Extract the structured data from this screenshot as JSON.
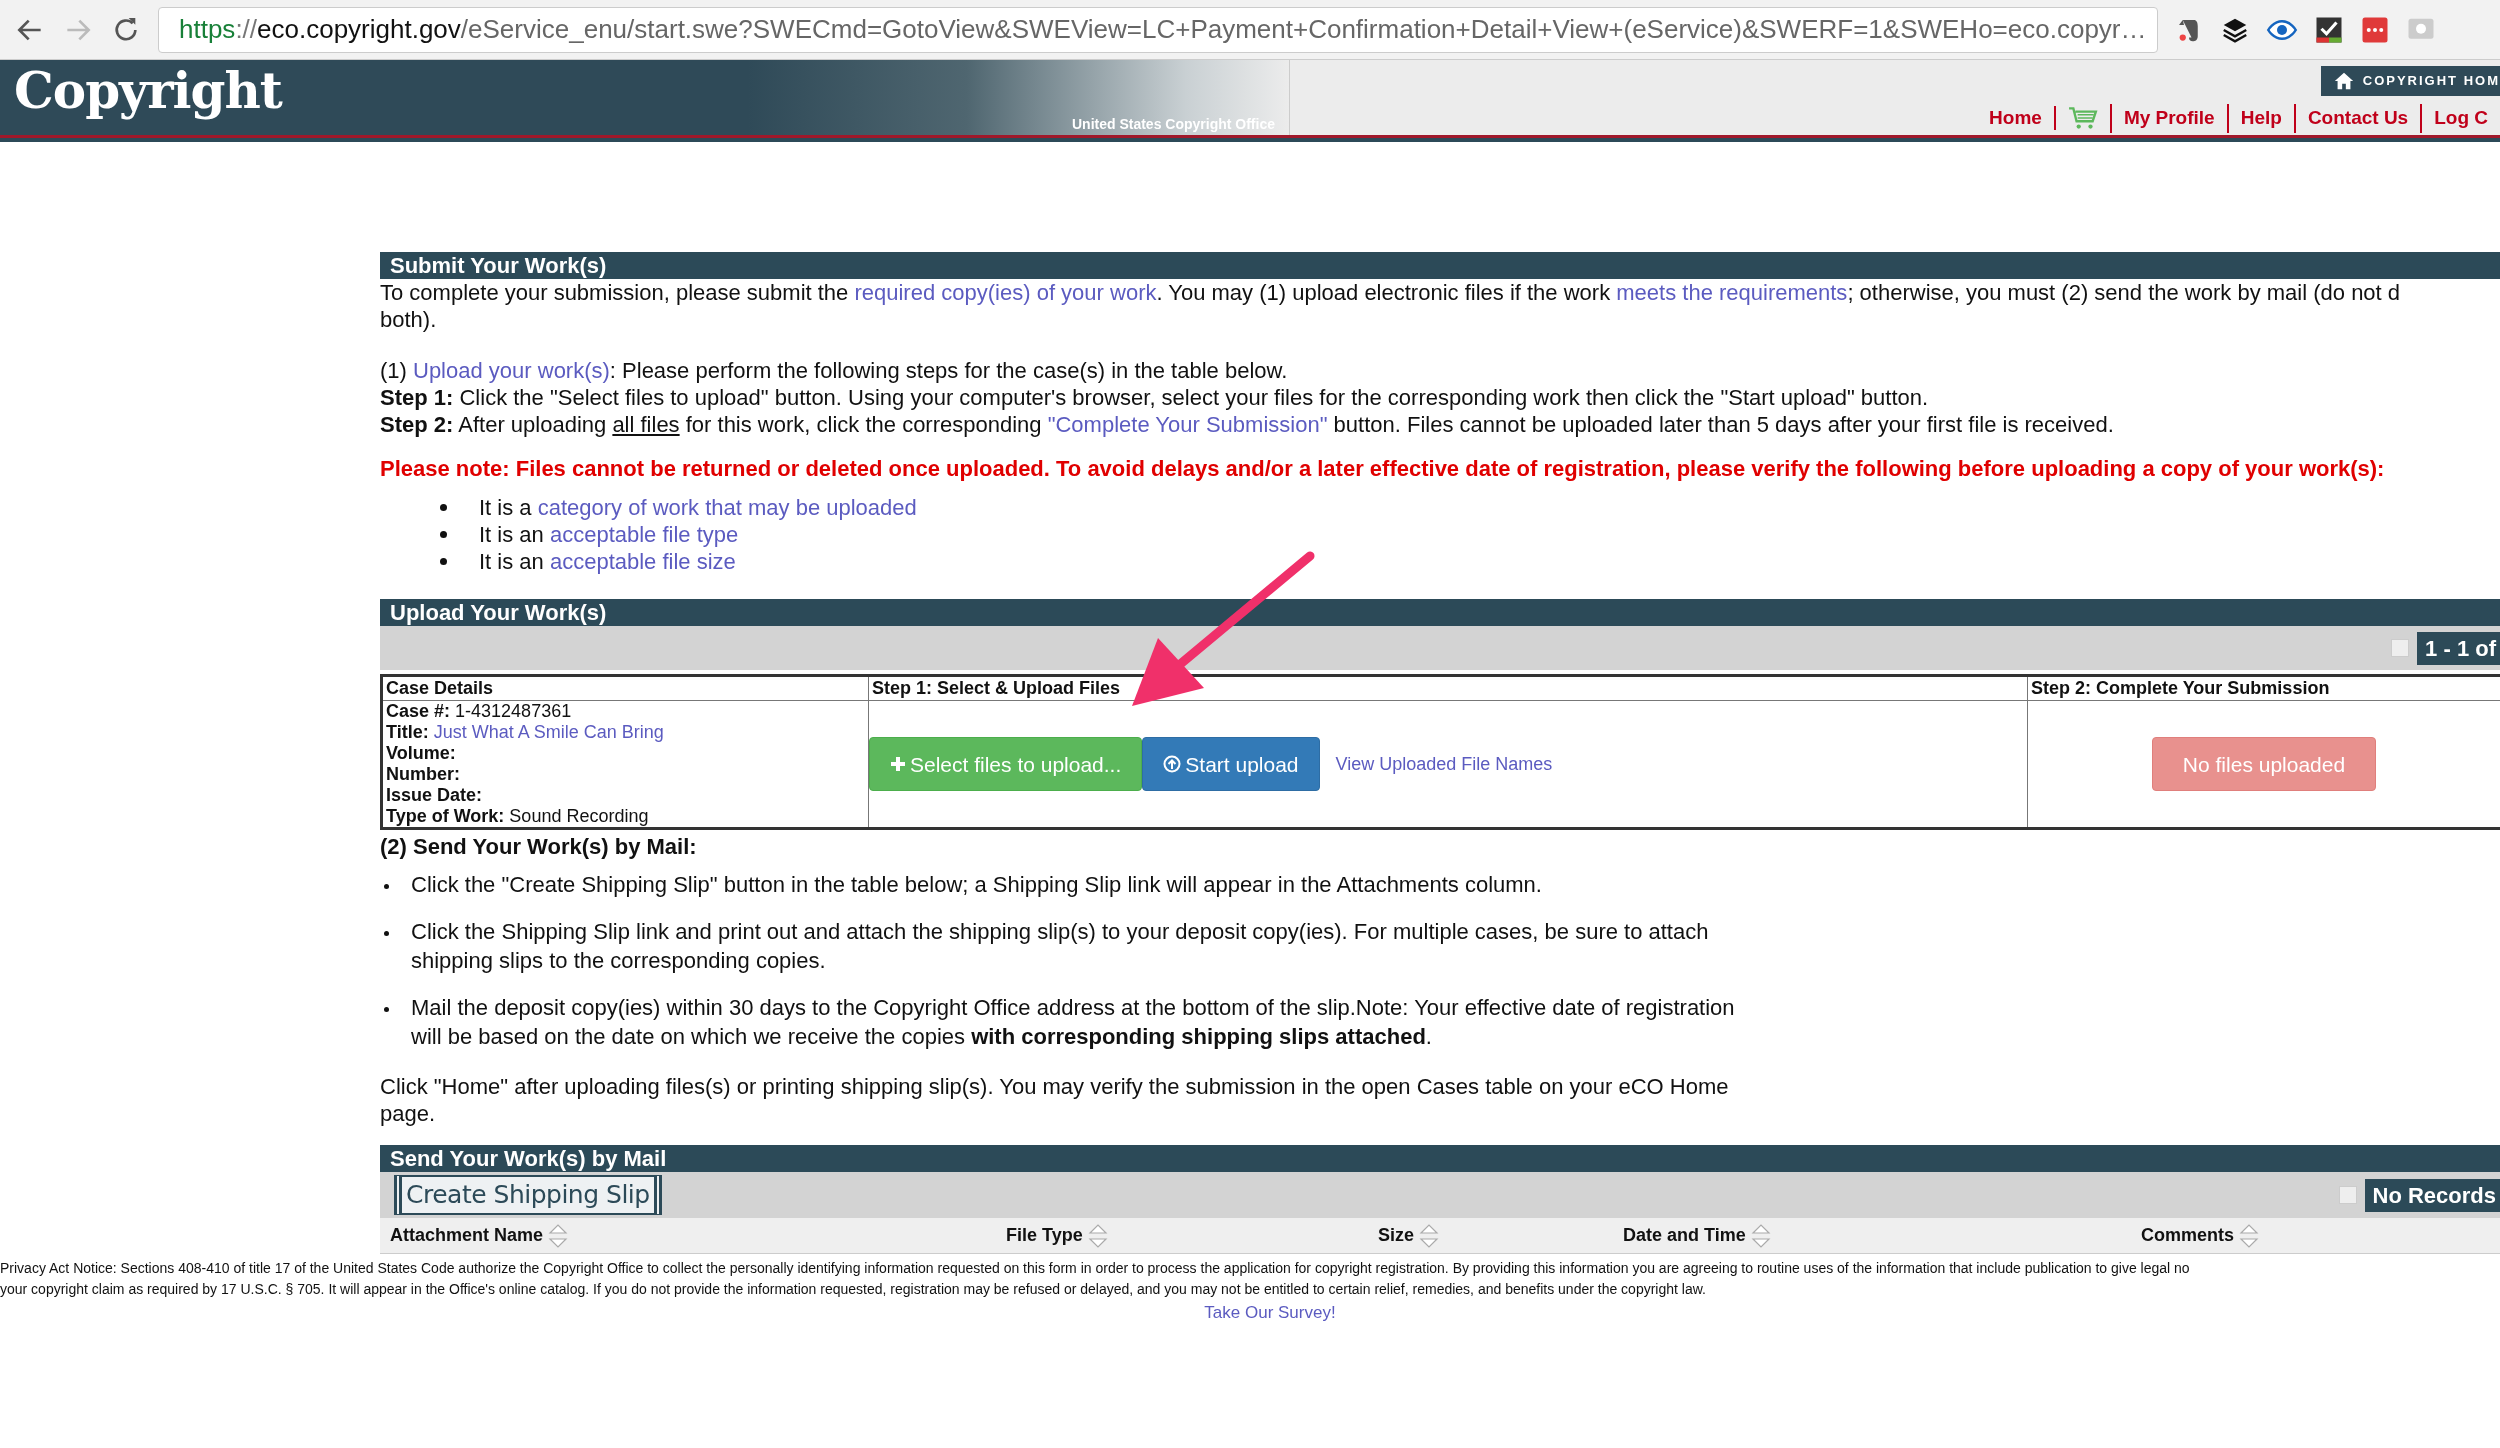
{
  "browser": {
    "url": {
      "scheme": "https",
      "separator": "://",
      "host": "eco.copyright.gov",
      "path": "/eService_enu/start.swe?SWECmd=GotoView&SWEView=LC+Payment+Confirmation+Detail+View+(eService)&SWERF=1&SWEHo=eco.copyr…"
    }
  },
  "header": {
    "logo": "Copyright",
    "logo_subtitle": "United States Copyright Office",
    "home_badge": "COPYRIGHT HOM",
    "nav": [
      {
        "kind": "link",
        "label": "Home"
      },
      {
        "kind": "cart"
      },
      {
        "kind": "link",
        "label": "My Profile"
      },
      {
        "kind": "link",
        "label": "Help"
      },
      {
        "kind": "link",
        "label": "Contact Us"
      },
      {
        "kind": "link",
        "label": "Log C"
      }
    ]
  },
  "submit_section": {
    "title": "Submit Your Work(s)",
    "intro_lines": [
      [
        {
          "kind": "text",
          "text": "To complete your submission, please submit the "
        },
        {
          "kind": "link",
          "text": "required copy(ies) of your work"
        },
        {
          "kind": "text",
          "text": ". You may (1) upload electronic files if the work "
        },
        {
          "kind": "link",
          "text": "meets the requirements"
        },
        {
          "kind": "text",
          "text": "; otherwise, you must (2) send the work by mail (do not d"
        }
      ],
      [
        {
          "kind": "text",
          "text": "both)."
        }
      ]
    ],
    "upload_line": [
      {
        "kind": "text",
        "text": "(1) "
      },
      {
        "kind": "link",
        "text": "Upload your work(s)"
      },
      {
        "kind": "text",
        "text": ": Please perform the following steps for the case(s) in the table below."
      }
    ],
    "steps": [
      [
        {
          "kind": "bold",
          "text": "Step 1:"
        },
        {
          "kind": "text",
          "text": " Click the \"Select files to upload\" button. Using your computer's browser, select your files for the corresponding work then click the \"Start upload\" button."
        }
      ],
      [
        {
          "kind": "bold",
          "text": "Step 2:"
        },
        {
          "kind": "text",
          "text": " After uploading "
        },
        {
          "kind": "underline",
          "text": "all files"
        },
        {
          "kind": "text",
          "text": " for this work, click the corresponding "
        },
        {
          "kind": "link",
          "text": "\"Complete Your Submission\""
        },
        {
          "kind": "text",
          "text": " button. Files cannot be uploaded later than 5 days after your first file is received."
        }
      ]
    ],
    "note": "Please note: Files cannot be returned or deleted once uploaded. To avoid delays and/or a later effective date of registration, please verify the following before uploading a copy of your work(s):",
    "checks": [
      [
        {
          "kind": "text",
          "text": "It is a "
        },
        {
          "kind": "link",
          "text": "category of work that may be uploaded"
        }
      ],
      [
        {
          "kind": "text",
          "text": "It is an "
        },
        {
          "kind": "link",
          "text": "acceptable file type"
        }
      ],
      [
        {
          "kind": "text",
          "text": "It is an "
        },
        {
          "kind": "link",
          "text": "acceptable file size"
        }
      ]
    ]
  },
  "upload_section": {
    "title": "Upload Your Work(s)",
    "pager": "1 - 1 of",
    "columns": [
      "Case Details",
      "Step 1: Select & Upload Files",
      "Step 2: Complete Your Submission"
    ],
    "case_fields": [
      {
        "label": "Case #:",
        "value": "1-4312487361",
        "kind": "text"
      },
      {
        "label": "Title:",
        "value": "Just What A Smile Can Bring",
        "kind": "link"
      },
      {
        "label": "Volume:"
      },
      {
        "label": "Number:"
      },
      {
        "label": "Issue Date:"
      },
      {
        "label": "Type of Work:",
        "value": "Sound Recording",
        "kind": "text"
      }
    ],
    "select_button": "Select files to upload...",
    "start_button": "Start upload",
    "view_link": "View Uploaded File Names",
    "complete_button": {
      "label": "No files uploaded",
      "disabled": true
    }
  },
  "mail_section": {
    "heading": "(2) Send Your Work(s) by Mail:",
    "items": [
      [
        {
          "kind": "text",
          "text": "Click the \"Create Shipping Slip\" button in the table below; a Shipping Slip link will appear in the Attachments column."
        }
      ],
      [
        {
          "kind": "text",
          "text": "Click the Shipping Slip link and print out and attach the shipping slip(s) to your deposit copy(ies). For multiple cases, be sure to attach shipping slips to the corresponding copies."
        }
      ],
      [
        {
          "kind": "text",
          "text": "Mail the deposit copy(ies) within 30 days to the Copyright Office address at the bottom of the slip.Note: Your effective date of registration will be based on the date on which we receive the copies "
        },
        {
          "kind": "bold",
          "text": "with corresponding shipping slips attached"
        },
        {
          "kind": "text",
          "text": "."
        }
      ]
    ],
    "closing": "Click \"Home\" after uploading files(s) or printing shipping slip(s). You may verify the submission in the open Cases table on your eCO Home page."
  },
  "mail_table": {
    "title": "Send Your Work(s) by Mail",
    "create_button": "Create Shipping Slip",
    "status": "No Records",
    "columns": [
      "Attachment Name",
      "File Type",
      "Size",
      "Date and Time",
      "Comments"
    ]
  },
  "footer": {
    "privacy_lines": [
      "Privacy Act Notice: Sections 408-410 of title 17 of the United States Code authorize the Copyright Office to collect the personally identifying information requested on this form in order to process the application for copyright registration. By providing this information you are agreeing to routine uses of the information that include publication to give legal no",
      "your copyright claim as required by 17 U.S.C. § 705. It will appear in the Office's online catalog. If you do not provide the information requested, registration may be refused or delayed, and you may not be entitled to certain relief, remedies, and benefits under the copyright law."
    ],
    "survey_link": "Take Our Survey!"
  }
}
